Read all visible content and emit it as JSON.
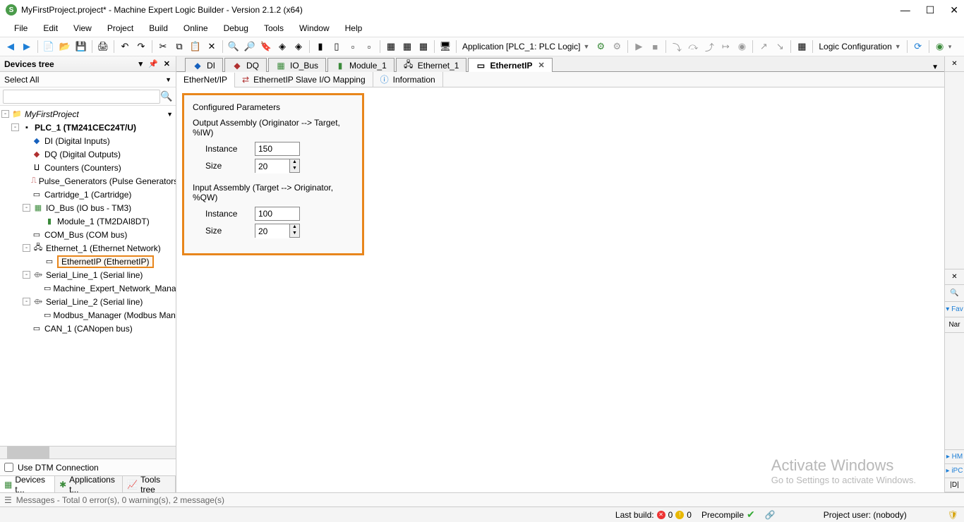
{
  "titlebar": {
    "title": "MyFirstProject.project* - Machine Expert Logic Builder - Version 2.1.2 (x64)"
  },
  "menu": [
    "File",
    "Edit",
    "View",
    "Project",
    "Build",
    "Online",
    "Debug",
    "Tools",
    "Window",
    "Help"
  ],
  "toolbar": {
    "app_context": "Application [PLC_1: PLC Logic]",
    "logic_config": "Logic Configuration"
  },
  "devices_panel": {
    "title": "Devices tree",
    "select_all": "Select All",
    "use_dtm": "Use DTM Connection",
    "bottom_tabs": [
      "Devices t...",
      "Applications t...",
      "Tools tree"
    ],
    "project": "MyFirstProject",
    "plc": "PLC_1 (TM241CEC24T/U)",
    "items": {
      "di": "DI (Digital Inputs)",
      "dq": "DQ (Digital Outputs)",
      "counters": "Counters (Counters)",
      "pulse": "Pulse_Generators (Pulse Generators)",
      "cartridge": "Cartridge_1 (Cartridge)",
      "iobus": "IO_Bus (IO bus - TM3)",
      "module1": "Module_1 (TM2DAI8DT)",
      "combus": "COM_Bus (COM bus)",
      "eth1": "Ethernet_1 (Ethernet Network)",
      "ethip": "EthernetIP (EthernetIP)",
      "serial1": "Serial_Line_1 (Serial line)",
      "menm": "Machine_Expert_Network_Manage",
      "serial2": "Serial_Line_2 (Serial line)",
      "modbus": "Modbus_Manager (Modbus Manag",
      "can": "CAN_1 (CANopen bus)"
    }
  },
  "doc_tabs": [
    "DI",
    "DQ",
    "IO_Bus",
    "Module_1",
    "Ethernet_1",
    "EthernetIP"
  ],
  "sub_tabs": [
    "EtherNet/IP",
    "EthernetIP Slave I/O Mapping",
    "Information"
  ],
  "config": {
    "title": "Configured Parameters",
    "output_grp": "Output Assembly (Originator --> Target, %IW)",
    "input_grp": "Input Assembly (Target --> Originator, %QW)",
    "instance_lbl": "Instance",
    "size_lbl": "Size",
    "out_instance": "150",
    "out_size": "20",
    "in_instance": "100",
    "in_size": "20"
  },
  "right": {
    "fav": "▾ Fav",
    "nar": "Nar",
    "hm": "▸ HM",
    "ipc": "▸ iPC",
    "d": "|D|"
  },
  "watermark": {
    "l1": "Activate Windows",
    "l2": "Go to Settings to activate Windows."
  },
  "msgbar": "Messages - Total 0 error(s), 0 warning(s), 2 message(s)",
  "status": {
    "lastbuild": "Last build:",
    "err": "0",
    "warn": "0",
    "precompile": "Precompile",
    "user": "Project user: (nobody)"
  }
}
